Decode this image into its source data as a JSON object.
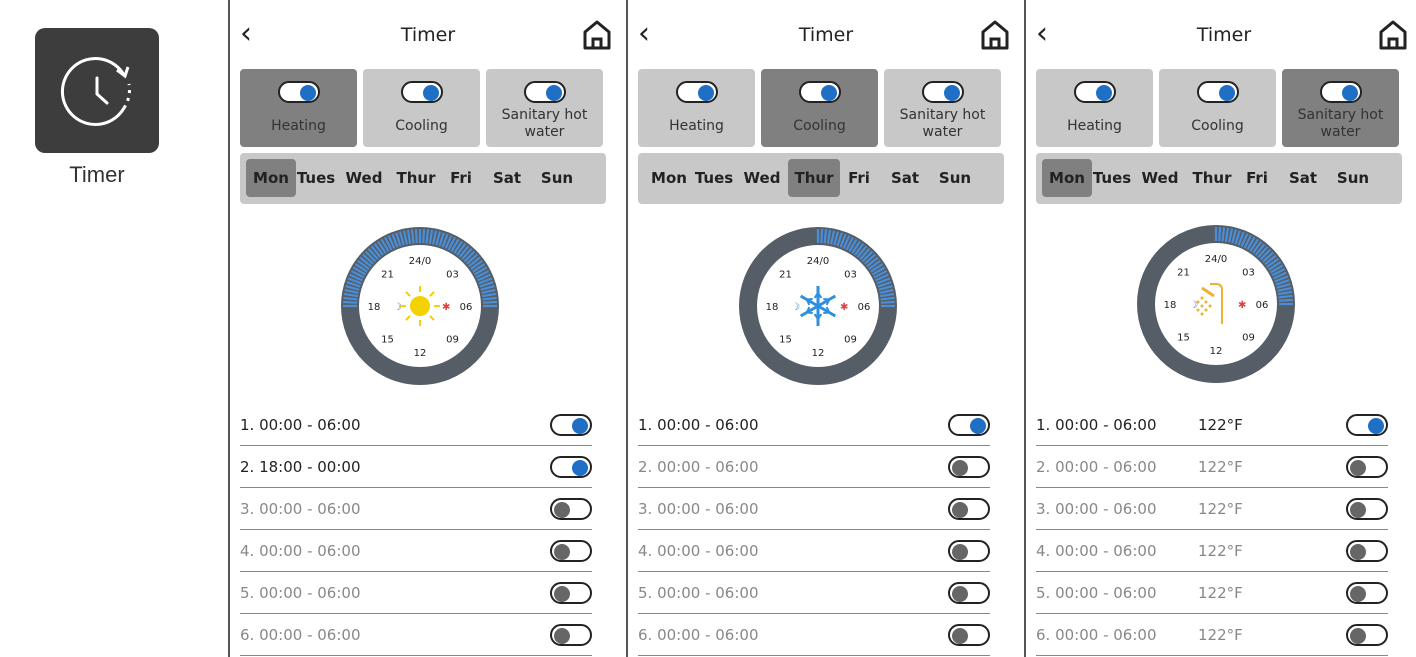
{
  "left": {
    "app_label": "Timer"
  },
  "colors": {
    "accent": "#1f6fc4",
    "active_mode": "#808080",
    "inactive_mode": "#c8c8c8",
    "ring": "#555d66",
    "ring_active": "#4a8ed8",
    "sun": "#f3d200",
    "snow": "#2e8ee0",
    "shower": "#f0b030"
  },
  "panels": [
    {
      "title": "Timer",
      "modes": [
        {
          "label": "Heating",
          "active": true
        },
        {
          "label": "Cooling",
          "active": false
        },
        {
          "label": "Sanitary hot water",
          "active": false
        }
      ],
      "days": [
        "Mon",
        "Tues",
        "Wed",
        "Thur",
        "Fri",
        "Sat",
        "Sun"
      ],
      "selected_day": "Mon",
      "dial": {
        "icon": "sun-icon",
        "labels": [
          "24/0",
          "03",
          "06",
          "09",
          "12",
          "15",
          "18",
          "21"
        ],
        "active_hours": [
          18,
          6
        ]
      },
      "slots": [
        {
          "label": "1. 00:00 - 06:00",
          "on": true
        },
        {
          "label": "2. 18:00 - 00:00",
          "on": true
        },
        {
          "label": "3. 00:00 - 06:00",
          "on": false
        },
        {
          "label": "4. 00:00 - 06:00",
          "on": false
        },
        {
          "label": "5. 00:00 - 06:00",
          "on": false
        },
        {
          "label": "6. 00:00 - 06:00",
          "on": false
        }
      ]
    },
    {
      "title": "Timer",
      "modes": [
        {
          "label": "Heating",
          "active": false
        },
        {
          "label": "Cooling",
          "active": true
        },
        {
          "label": "Sanitary hot water",
          "active": false
        }
      ],
      "days": [
        "Mon",
        "Tues",
        "Wed",
        "Thur",
        "Fri",
        "Sat",
        "Sun"
      ],
      "selected_day": "Thur",
      "dial": {
        "icon": "snowflake-icon",
        "labels": [
          "24/0",
          "03",
          "06",
          "09",
          "12",
          "15",
          "18",
          "21"
        ],
        "active_hours": [
          0,
          6
        ]
      },
      "slots": [
        {
          "label": "1. 00:00 - 06:00",
          "on": true
        },
        {
          "label": "2. 00:00 - 06:00",
          "on": false
        },
        {
          "label": "3. 00:00 - 06:00",
          "on": false
        },
        {
          "label": "4. 00:00 - 06:00",
          "on": false
        },
        {
          "label": "5. 00:00 - 06:00",
          "on": false
        },
        {
          "label": "6. 00:00 - 06:00",
          "on": false
        }
      ]
    },
    {
      "title": "Timer",
      "modes": [
        {
          "label": "Heating",
          "active": false
        },
        {
          "label": "Cooling",
          "active": false
        },
        {
          "label": "Sanitary hot water",
          "active": true
        }
      ],
      "days": [
        "Mon",
        "Tues",
        "Wed",
        "Thur",
        "Fri",
        "Sat",
        "Sun"
      ],
      "selected_day": "Mon",
      "dial": {
        "icon": "shower-icon",
        "labels": [
          "24/0",
          "03",
          "06",
          "09",
          "12",
          "15",
          "18",
          "21"
        ],
        "active_hours": [
          0,
          6
        ]
      },
      "slots": [
        {
          "label": "1. 00:00 - 06:00",
          "temp": "122°F",
          "on": true
        },
        {
          "label": "2. 00:00 - 06:00",
          "temp": "122°F",
          "on": false
        },
        {
          "label": "3. 00:00 - 06:00",
          "temp": "122°F",
          "on": false
        },
        {
          "label": "4. 00:00 - 06:00",
          "temp": "122°F",
          "on": false
        },
        {
          "label": "5. 00:00 - 06:00",
          "temp": "122°F",
          "on": false
        },
        {
          "label": "6. 00:00 - 06:00",
          "temp": "122°F",
          "on": false
        }
      ]
    }
  ]
}
